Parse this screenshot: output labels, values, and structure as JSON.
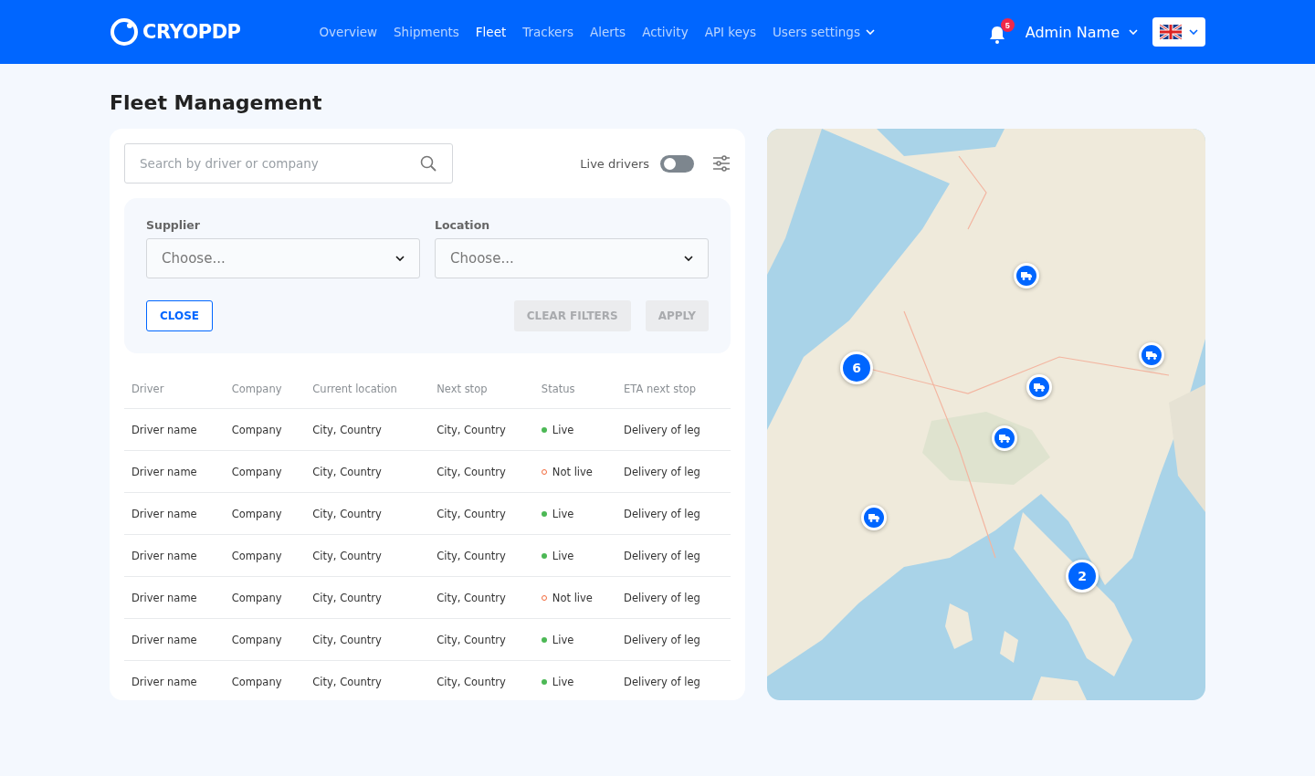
{
  "header": {
    "logo": "CRYOPDP",
    "nav": [
      {
        "label": "Overview",
        "selected": false
      },
      {
        "label": "Shipments",
        "selected": false
      },
      {
        "label": "Fleet",
        "selected": true
      },
      {
        "label": "Trackers",
        "selected": false
      },
      {
        "label": "Alerts",
        "selected": false
      },
      {
        "label": "Activity",
        "selected": false
      },
      {
        "label": "API keys",
        "selected": false
      },
      {
        "label": "Users settings",
        "selected": false,
        "dropdown": true
      }
    ],
    "notifications": "5",
    "user": "Admin Name"
  },
  "title": "Fleet Management",
  "search": {
    "placeholder": "Search by driver or company"
  },
  "live_drivers": {
    "label": "Live drivers",
    "on": false
  },
  "filters": {
    "fields": [
      {
        "label": "Supplier",
        "placeholder": "Choose..."
      },
      {
        "label": "Location",
        "placeholder": "Choose..."
      }
    ],
    "close": "CLOSE",
    "clear": {
      "label": "CLEAR FILTERS",
      "disabled": true
    },
    "apply": {
      "label": "APPLY",
      "disabled": true
    }
  },
  "table": {
    "columns": [
      "Driver",
      "Company",
      "Current location",
      "Next stop",
      "Status",
      "ETA next stop"
    ],
    "rows": [
      {
        "driver": "Driver name",
        "company": "Company",
        "location": "City, Country",
        "next": "City, Country",
        "status": "Live",
        "live": true,
        "eta": "Delivery of leg"
      },
      {
        "driver": "Driver name",
        "company": "Company",
        "location": "City, Country",
        "next": "City, Country",
        "status": "Not live",
        "live": false,
        "eta": "Delivery of leg"
      },
      {
        "driver": "Driver name",
        "company": "Company",
        "location": "City, Country",
        "next": "City, Country",
        "status": "Live",
        "live": true,
        "eta": "Delivery of leg"
      },
      {
        "driver": "Driver name",
        "company": "Company",
        "location": "City, Country",
        "next": "City, Country",
        "status": "Live",
        "live": true,
        "eta": "Delivery of leg"
      },
      {
        "driver": "Driver name",
        "company": "Company",
        "location": "City, Country",
        "next": "City, Country",
        "status": "Not live",
        "live": false,
        "eta": "Delivery of leg"
      },
      {
        "driver": "Driver name",
        "company": "Company",
        "location": "City, Country",
        "next": "City, Country",
        "status": "Live",
        "live": true,
        "eta": "Delivery of leg"
      },
      {
        "driver": "Driver name",
        "company": "Company",
        "location": "City, Country",
        "next": "City, Country",
        "status": "Live",
        "live": true,
        "eta": "Delivery of leg"
      }
    ]
  },
  "map": {
    "kind": "picture",
    "markers": [
      {
        "kind": "truck"
      },
      {
        "kind": "cluster",
        "count": "6"
      },
      {
        "kind": "truck"
      },
      {
        "kind": "truck"
      },
      {
        "kind": "truck"
      },
      {
        "kind": "truck"
      },
      {
        "kind": "cluster",
        "count": "2"
      }
    ]
  }
}
